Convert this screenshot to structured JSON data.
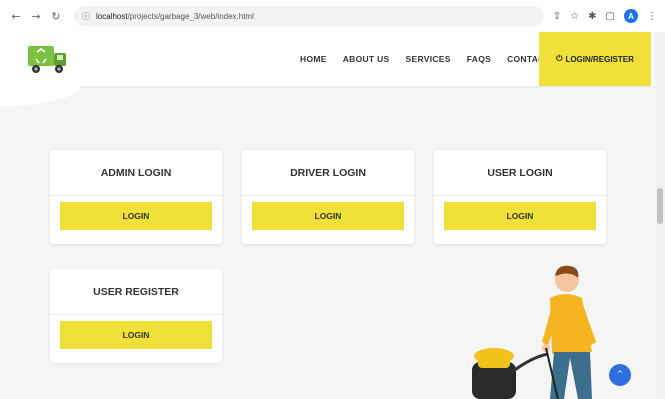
{
  "browser": {
    "url_host": "localhost",
    "url_path": "/projects/garbage_3/web/index.html",
    "profile_initial": "A"
  },
  "nav": {
    "items": [
      "HOME",
      "ABOUT US",
      "SERVICES",
      "FAQS",
      "CONTACT"
    ],
    "login_register": "LOGIN/REGISTER"
  },
  "cards": [
    {
      "title": "ADMIN LOGIN",
      "button": "LOGIN"
    },
    {
      "title": "DRIVER LOGIN",
      "button": "LOGIN"
    },
    {
      "title": "USER LOGIN",
      "button": "LOGIN"
    },
    {
      "title": "USER REGISTER",
      "button": "LOGIN"
    }
  ],
  "colors": {
    "accent": "#f0e03a",
    "background": "#f5f5f5",
    "back_to_top": "#2f6ee0"
  },
  "icons": {
    "logo": "garbage-truck-icon",
    "back_to_top": "chevron-up-icon"
  }
}
